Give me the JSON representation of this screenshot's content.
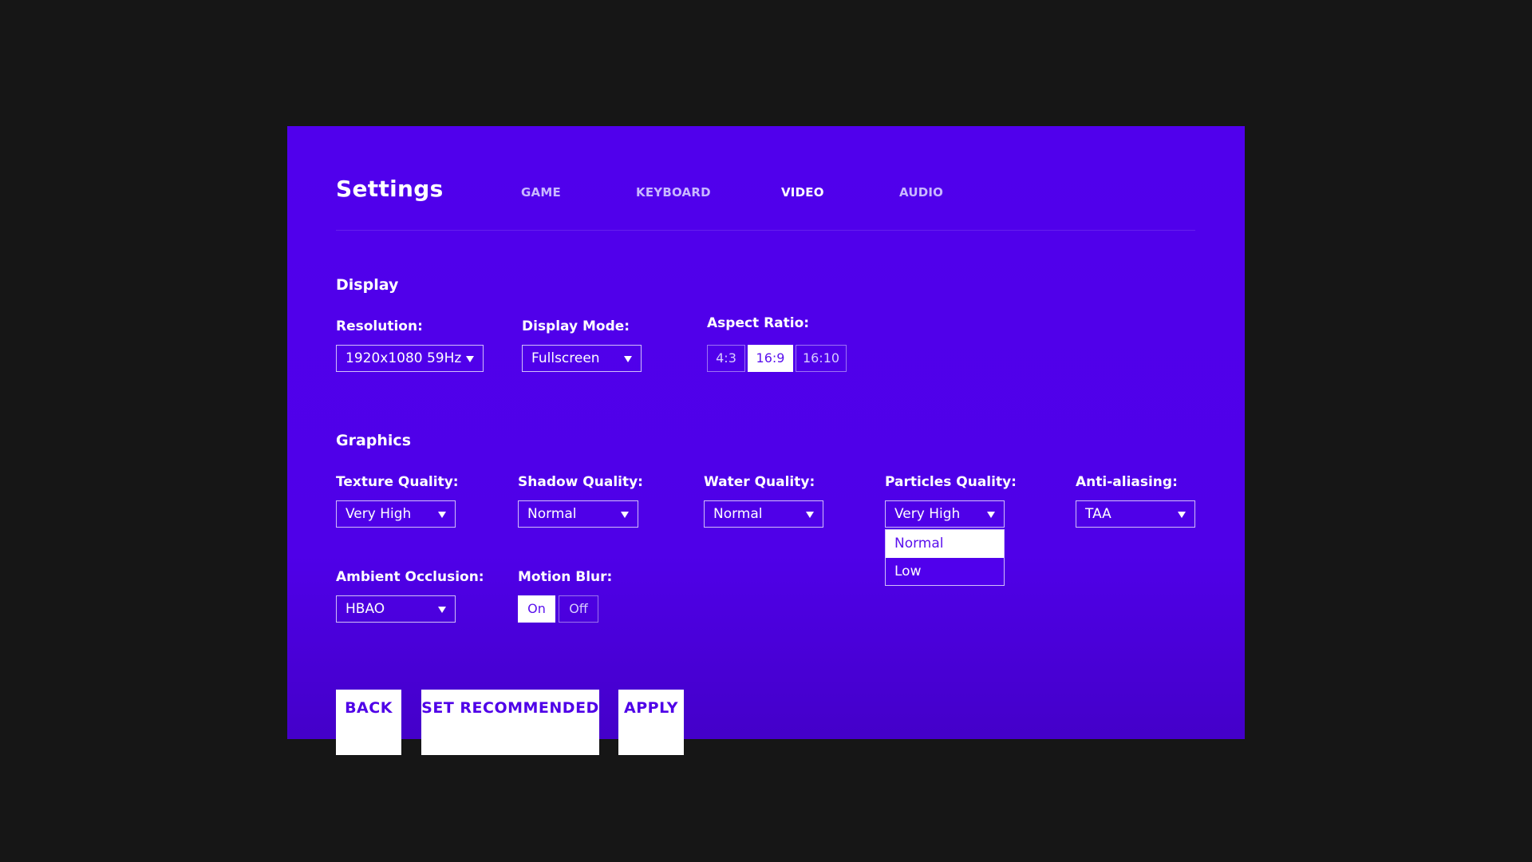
{
  "header": {
    "title": "Settings",
    "tabs": [
      {
        "label": "GAME",
        "active": false
      },
      {
        "label": "KEYBOARD",
        "active": false
      },
      {
        "label": "VIDEO",
        "active": true
      },
      {
        "label": "AUDIO",
        "active": false
      }
    ]
  },
  "display": {
    "heading": "Display",
    "resolution": {
      "label": "Resolution:",
      "value": "1920x1080 59Hz"
    },
    "display_mode": {
      "label": "Display Mode:",
      "value": "Fullscreen"
    },
    "aspect_ratio": {
      "label": "Aspect Ratio:",
      "options": [
        "4:3",
        "16:9",
        "16:10"
      ],
      "selected": "16:9"
    }
  },
  "graphics": {
    "heading": "Graphics",
    "texture_quality": {
      "label": "Texture Quality:",
      "value": "Very High"
    },
    "shadow_quality": {
      "label": "Shadow Quality:",
      "value": "Normal"
    },
    "water_quality": {
      "label": "Water Quality:",
      "value": "Normal"
    },
    "particles_quality": {
      "label": "Particles Quality:",
      "value": "Very High",
      "open_options": [
        "Normal",
        "Low"
      ],
      "highlighted": "Normal"
    },
    "anti_aliasing": {
      "label": "Anti-aliasing:",
      "value": "TAA"
    },
    "ambient_occlusion": {
      "label": "Ambient Occlusion:",
      "value": "HBAO"
    },
    "motion_blur": {
      "label": "Motion Blur:",
      "options": [
        "On",
        "Off"
      ],
      "selected": "On"
    }
  },
  "footer": {
    "back_label": "BACK",
    "recommended_label": "SET RECOMMENDED",
    "apply_label": "APPLY"
  },
  "colors": {
    "page_background": "#161616",
    "panel_background": "#5000ec",
    "accent_text": "#4f00e8",
    "text": "#ffffff"
  },
  "icons": {
    "select_caret": "chevron-down-icon"
  }
}
